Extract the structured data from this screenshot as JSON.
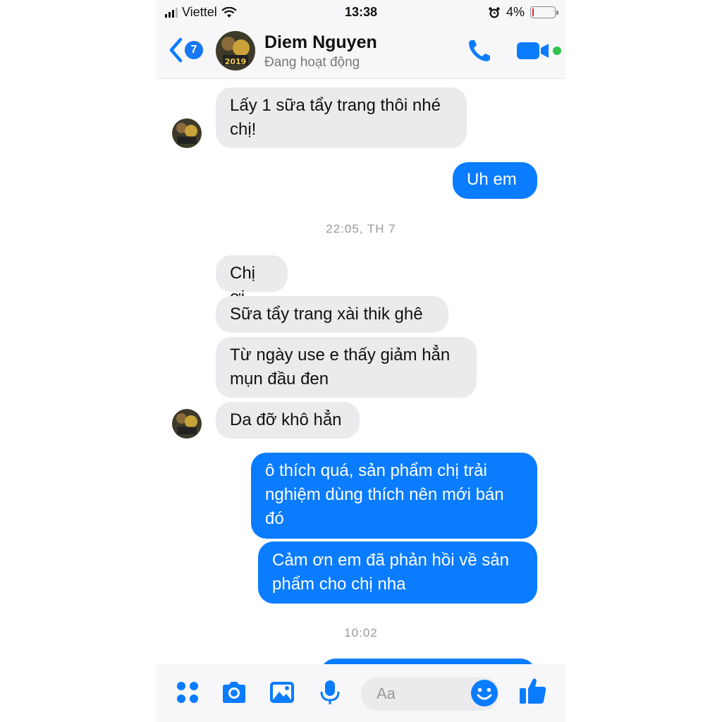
{
  "status_bar": {
    "carrier": "Viettel",
    "time": "13:38",
    "battery": "4%",
    "battery_level": 0.04
  },
  "header": {
    "back_count": "7",
    "contact_name": "Diem Nguyen",
    "contact_status": "Đang hoạt động",
    "avatar_label": "2019"
  },
  "messages": [
    {
      "side": "in",
      "text_lines": [
        "Lấy 1 sữa tẩy trang thôi nhé",
        "chị!"
      ]
    },
    {
      "side": "out",
      "text_lines": [
        "Uh em"
      ]
    },
    {
      "side": "in",
      "text_lines": [
        "Chị ơi"
      ]
    },
    {
      "side": "in",
      "text_lines": [
        "Sữa tẩy trang xài thik ghê"
      ]
    },
    {
      "side": "in",
      "text_lines": [
        "Từ ngày use e thấy giảm hẳn",
        "mụn đầu đen"
      ]
    },
    {
      "side": "in",
      "text_lines": [
        "Da đỡ khô hẳn"
      ]
    },
    {
      "side": "out",
      "text_lines": [
        "ô thích quá, sản phẩm chị trải",
        "nghiệm dùng thích nên mới bán",
        "đó"
      ]
    },
    {
      "side": "out",
      "text_lines": [
        "Cảm ơn em đã phản hồi về sản",
        "phẩm cho chị nha"
      ]
    }
  ],
  "timestamps": [
    "22:05, TH 7",
    "10:02"
  ],
  "composer": {
    "placeholder": "Aa"
  },
  "colors": {
    "accent": "#0a7cff",
    "incoming_bubble": "#ebebee",
    "online": "#31c44f"
  },
  "icons": {
    "back": "chevron-left-icon",
    "call": "phone-icon",
    "video": "video-camera-icon",
    "apps": "four-dots-icon",
    "camera": "camera-icon",
    "gallery": "image-icon",
    "mic": "microphone-icon",
    "emoji": "smiley-icon",
    "like": "thumbs-up-icon"
  }
}
